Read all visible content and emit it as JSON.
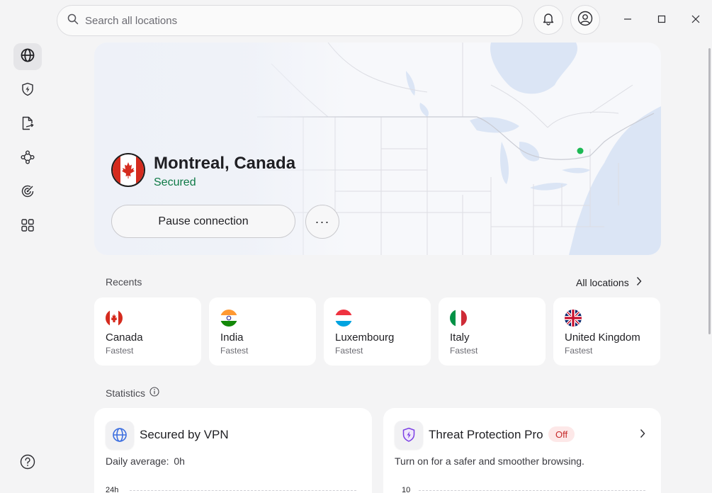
{
  "search": {
    "placeholder": "Search all locations"
  },
  "window_controls": [
    "minimize",
    "maximize",
    "close"
  ],
  "sidebar": {
    "items": [
      {
        "icon": "globe-icon",
        "active": true
      },
      {
        "icon": "bolt-shield-icon",
        "active": false
      },
      {
        "icon": "file-share-icon",
        "active": false
      },
      {
        "icon": "meshnet-icon",
        "active": false
      },
      {
        "icon": "radar-icon",
        "active": false
      },
      {
        "icon": "apps-grid-icon",
        "active": false
      }
    ],
    "help_icon": "help-icon"
  },
  "connection": {
    "location": "Montreal, Canada",
    "status": "Secured",
    "pause_label": "Pause connection",
    "more_label": "···",
    "status_color": "#0e7a46",
    "pin_color": "#1db954"
  },
  "recents": {
    "title": "Recents",
    "all_locations": "All locations",
    "items": [
      {
        "country": "Canada",
        "sub": "Fastest",
        "flag": "canada-flag-icon"
      },
      {
        "country": "India",
        "sub": "Fastest",
        "flag": "india-flag-icon"
      },
      {
        "country": "Luxembourg",
        "sub": "Fastest",
        "flag": "luxembourg-flag-icon"
      },
      {
        "country": "Italy",
        "sub": "Fastest",
        "flag": "italy-flag-icon"
      },
      {
        "country": "United Kingdom",
        "sub": "Fastest",
        "flag": "uk-flag-icon"
      }
    ]
  },
  "statistics": {
    "title": "Statistics",
    "vpn": {
      "title": "Secured by VPN",
      "daily_label": "Daily average:",
      "daily_value": "0h",
      "axis_top": "24h"
    },
    "threat": {
      "title": "Threat Protection Pro",
      "badge": "Off",
      "description": "Turn on for a safer and smoother browsing.",
      "axis_top": "10"
    }
  }
}
